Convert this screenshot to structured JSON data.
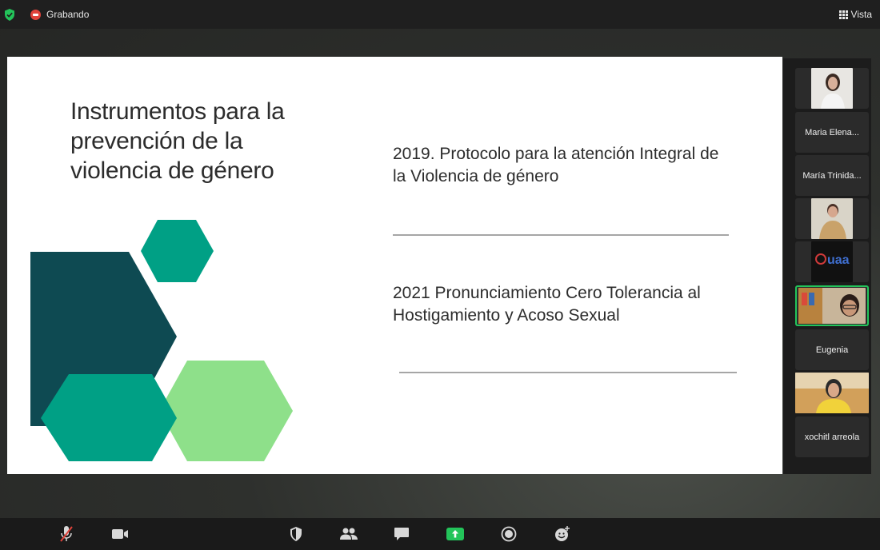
{
  "topbar": {
    "recording_label": "Grabando",
    "view_label": "Vista"
  },
  "slide": {
    "title": "Instrumentos para la prevención de la violencia de género",
    "items": [
      "2019. Protocolo para la atención Integral de la Violencia de género",
      "2021 Pronunciamiento Cero Tolerancia al Hostigamiento y Acoso Sexual"
    ],
    "colors": {
      "dark_teal": "#0e4a52",
      "teal": "#00a085",
      "light_green": "#8ee08a"
    }
  },
  "participants": [
    {
      "type": "video",
      "icon": "participant-video"
    },
    {
      "type": "name",
      "name": "Maria Elena..."
    },
    {
      "type": "name",
      "name": "María Trinida..."
    },
    {
      "type": "video",
      "icon": "participant-video"
    },
    {
      "type": "video",
      "icon": "uaa-logo",
      "logo_text": "uaa"
    },
    {
      "type": "video",
      "icon": "participant-video",
      "active": true
    },
    {
      "type": "name",
      "name": "Eugenia"
    },
    {
      "type": "video",
      "icon": "participant-video"
    },
    {
      "type": "name",
      "name": "xochitl arreola"
    }
  ],
  "toolbar": {
    "icons": [
      "mic-muted-icon",
      "video-camera-icon",
      "security-icon",
      "participants-icon",
      "chat-icon",
      "share-screen-icon",
      "record-icon",
      "reactions-icon"
    ],
    "share_color": "#23c45a"
  }
}
